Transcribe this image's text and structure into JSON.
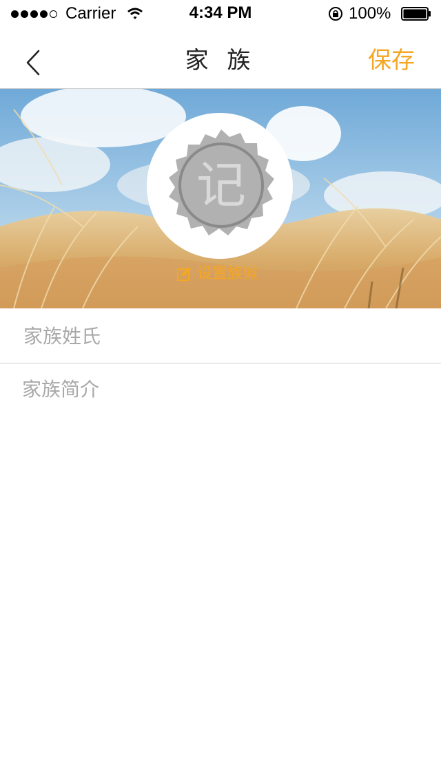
{
  "status_bar": {
    "carrier": "Carrier",
    "time": "4:34 PM",
    "battery_percent": "100%"
  },
  "nav": {
    "title": "家 族",
    "save_label": "保存"
  },
  "banner": {
    "seal_text": "记",
    "set_emblem_label": "设置族徽"
  },
  "form": {
    "surname_placeholder": "家族姓氏",
    "intro_placeholder": "家族简介"
  },
  "colors": {
    "accent": "#f5a623",
    "placeholder": "#a9a9a9"
  }
}
